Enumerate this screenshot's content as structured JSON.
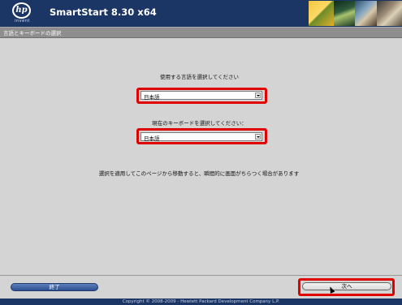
{
  "header": {
    "logo_text": "hp",
    "logo_subtext": "invent",
    "app_title": "SmartStart 8.30 x64"
  },
  "section": {
    "title": "言語とキーボードの選択"
  },
  "language": {
    "label": "使用する言語を選択してください",
    "selected": "日本語"
  },
  "keyboard": {
    "label": "現在のキーボードを選択してください：",
    "selected": "日本語"
  },
  "notice": "選択を適用してこのページから移動すると、瞬間的に画面がちらつく場合があります",
  "buttons": {
    "exit_label": "終了",
    "next_label": "次へ"
  },
  "footer": {
    "copyright": "Copyright © 2008-2009 - Hewlett Packard Development Company L.P."
  },
  "colors": {
    "header_bg": "#1b3565",
    "highlight": "#e00000",
    "page_bg": "#d4d4d4"
  }
}
